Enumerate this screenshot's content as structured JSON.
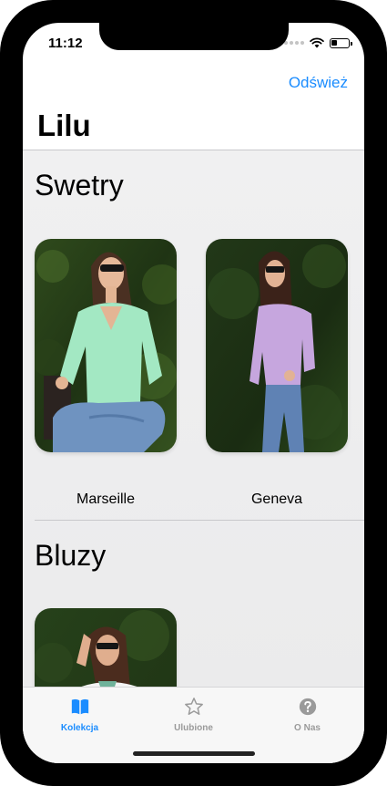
{
  "status_bar": {
    "time": "11:12"
  },
  "nav": {
    "refresh_label": "Odśwież",
    "title": "Lilu"
  },
  "sections": [
    {
      "title": "Swetry",
      "items": [
        {
          "name": "Marseille",
          "sweater_color": "#a3e8c3"
        },
        {
          "name": "Geneva",
          "sweater_color": "#c6a6de"
        }
      ]
    },
    {
      "title": "Bluzy",
      "items": [
        {
          "name": "",
          "sweater_color": "#f4f4f4"
        }
      ]
    }
  ],
  "tabbar": {
    "tabs": [
      {
        "label": "Kolekcja",
        "icon": "book-icon",
        "active": true
      },
      {
        "label": "Ulubione",
        "icon": "star-icon",
        "active": false
      },
      {
        "label": "O Nas",
        "icon": "question-circle-icon",
        "active": false
      }
    ]
  },
  "colors": {
    "accent": "#1a8cff",
    "inactive": "#9a9a9a"
  }
}
